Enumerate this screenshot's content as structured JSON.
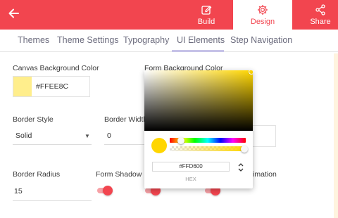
{
  "header": {
    "nav": [
      {
        "label": "Build",
        "icon": "edit-icon"
      },
      {
        "label": "Design",
        "icon": "gear-icon"
      },
      {
        "label": "Share",
        "icon": "share-icon"
      }
    ]
  },
  "tabs": [
    {
      "label": "Themes"
    },
    {
      "label": "Theme Settings"
    },
    {
      "label": "Typography"
    },
    {
      "label": "UI Elements"
    },
    {
      "label": "Step Navigation"
    }
  ],
  "fields": {
    "canvas_bg_label": "Canvas Background Color",
    "canvas_bg_value": "#FFEE8C",
    "form_bg_label": "Form Background Color",
    "border_style_label": "Border Style",
    "border_style_value": "Solid",
    "border_width_label": "Border Width",
    "border_width_value": "0",
    "border_radius_label": "Border Radius",
    "border_radius_value": "15",
    "form_shadow_label": "Form Shadow",
    "animation_label_fragment": "imation"
  },
  "toggles": {
    "form_shadow": true,
    "second": true,
    "third": true
  },
  "color_picker": {
    "hex_value": "#FFD600",
    "mode_label": "HEX",
    "alpha": 1
  },
  "colors": {
    "accent": "#f2454f",
    "canvas_bg": "#FFEE8C",
    "picker_color": "#FFD600",
    "tab_underline": "#c6c2e8"
  }
}
